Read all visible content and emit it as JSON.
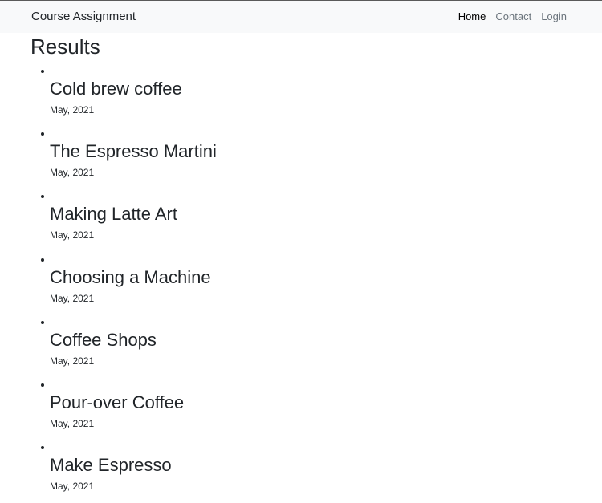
{
  "navbar": {
    "brand": "Course Assignment",
    "links": [
      {
        "label": "Home",
        "active": true
      },
      {
        "label": "Contact",
        "active": false
      },
      {
        "label": "Login",
        "active": false
      }
    ]
  },
  "main": {
    "title": "Results",
    "results": [
      {
        "title": "Cold brew coffee",
        "date": "May, 2021"
      },
      {
        "title": "The Espresso Martini",
        "date": "May, 2021"
      },
      {
        "title": "Making Latte Art",
        "date": "May, 2021"
      },
      {
        "title": "Choosing a Machine",
        "date": "May, 2021"
      },
      {
        "title": "Coffee Shops",
        "date": "May, 2021"
      },
      {
        "title": "Pour-over Coffee",
        "date": "May, 2021"
      },
      {
        "title": "Make Espresso",
        "date": "May, 2021"
      }
    ]
  },
  "colors": {
    "navbar_background": "#f8f9fa",
    "text": "#212529",
    "nav_link": "#6c757d",
    "nav_link_active": "#000000"
  }
}
